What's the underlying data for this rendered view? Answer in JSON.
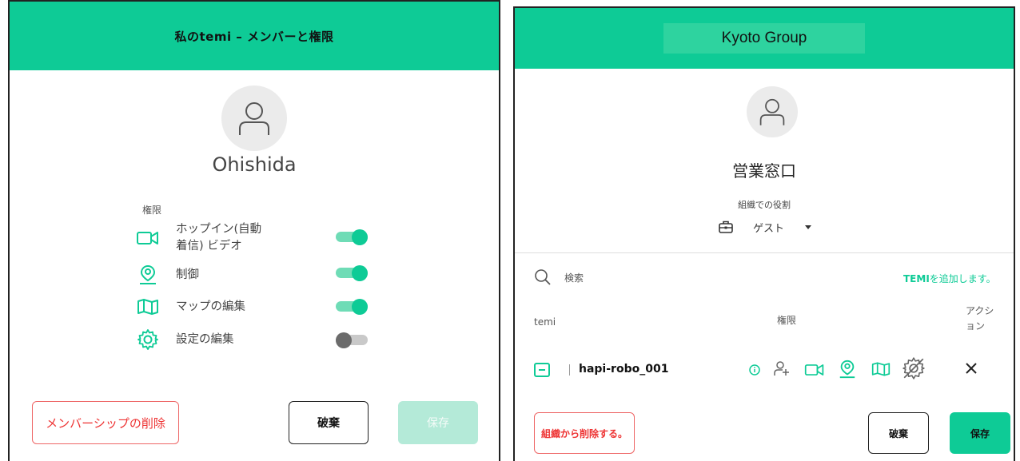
{
  "left": {
    "title": "私のtemi – メンバーと権限",
    "user_name": "Ohishida",
    "permissions_heading": "権限",
    "permissions": [
      {
        "label": "ホップイン(自動着信) ビデオ",
        "icon": "video-camera-icon",
        "enabled": true
      },
      {
        "label": "制御",
        "icon": "map-pin-person-icon",
        "enabled": true
      },
      {
        "label": "マップの編集",
        "icon": "map-icon",
        "enabled": true
      },
      {
        "label": "設定の編集",
        "icon": "gear-icon",
        "enabled": false
      }
    ],
    "delete_button": "メンバーシップの削除",
    "cancel_button": "破棄",
    "save_button": "保存"
  },
  "right": {
    "title": "Kyoto Group",
    "org_member_name": "営業窓口",
    "role_label": "組織での役割",
    "role_value": "ゲスト",
    "search_placeholder": "検索",
    "add_temi": "を追加します。",
    "add_temi_bold": "TEMI",
    "columns": {
      "temi": "temi",
      "permissions": "権限",
      "action": "アクション"
    },
    "robot_name": "hapi-robo_001",
    "remove_org_button": "組織から削除する。",
    "cancel_button": "破棄",
    "save_button": "保存"
  },
  "colors": {
    "accent": "#0ecb96",
    "danger": "#e33333",
    "toggle_off": "#6b6b6b"
  }
}
